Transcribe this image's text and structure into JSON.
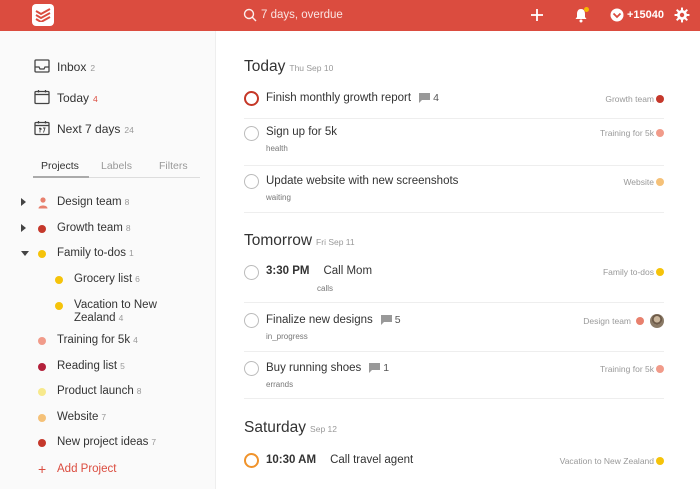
{
  "search": {
    "placeholder": "7 days, overdue"
  },
  "karma": {
    "value": "+15040"
  },
  "nav": [
    {
      "label": "Inbox",
      "count": "2",
      "icon": "inbox-icon"
    },
    {
      "label": "Today",
      "count": "4",
      "icon": "calendar-today-icon"
    },
    {
      "label": "Next 7 days",
      "count": "24",
      "icon": "calendar-week-icon"
    }
  ],
  "tabs": [
    "Projects",
    "Labels",
    "Filters"
  ],
  "projects": [
    {
      "label": "Design team",
      "count": "8",
      "color": "#e8806d",
      "caret": "right",
      "icon": "person"
    },
    {
      "label": "Growth team",
      "count": "8",
      "color": "#c5382b",
      "caret": "right"
    },
    {
      "label": "Family to-dos",
      "count": "1",
      "color": "#f5c30a",
      "caret": "down"
    },
    {
      "label": "Grocery list",
      "count": "6",
      "color": "#f5c30a",
      "indent": true
    },
    {
      "label": "Vacation to New",
      "label2": "Zealand",
      "count": "4",
      "color": "#f5c30a",
      "indent": true
    },
    {
      "label": "Training for 5k",
      "count": "4",
      "color": "#f19b8a"
    },
    {
      "label": "Reading list",
      "count": "5",
      "color": "#b3203a"
    },
    {
      "label": "Product launch",
      "count": "8",
      "color": "#f7e98c"
    },
    {
      "label": "Website",
      "count": "7",
      "color": "#f5c178"
    },
    {
      "label": "New project ideas",
      "count": "7",
      "color": "#c5382b"
    }
  ],
  "add_project": "Add Project",
  "sections": [
    {
      "title": "Today",
      "date": "Thu Sep 10",
      "tasks": [
        {
          "text": "Finish monthly growth report",
          "comments": "4",
          "project": "Growth team",
          "color": "#c5382b",
          "priority": "p1"
        },
        {
          "text": "Sign up for 5k",
          "sub": "health",
          "project": "Training for 5k",
          "color": "#f19b8a"
        },
        {
          "text": "Update website with new screenshots",
          "sub": "waiting",
          "project": "Website",
          "color": "#f5c178"
        }
      ]
    },
    {
      "title": "Tomorrow",
      "date": "Fri Sep 11",
      "tasks": [
        {
          "time": "3:30 PM",
          "text": "Call Mom",
          "sub": "calls",
          "project": "Family to-dos",
          "color": "#f5c30a"
        },
        {
          "text": "Finalize new designs",
          "comments": "5",
          "sub": "in_progress",
          "project": "Design team",
          "color": "#e8806d",
          "avatar": true
        },
        {
          "text": "Buy running shoes",
          "comments": "1",
          "sub": "errands",
          "project": "Training for 5k",
          "color": "#f19b8a"
        }
      ]
    },
    {
      "title": "Saturday",
      "date": "Sep 12",
      "tasks": [
        {
          "time": "10:30 AM",
          "text": "Call travel agent",
          "project": "Vacation to New Zealand",
          "color": "#f5c30a",
          "priority": "p2"
        }
      ]
    }
  ]
}
